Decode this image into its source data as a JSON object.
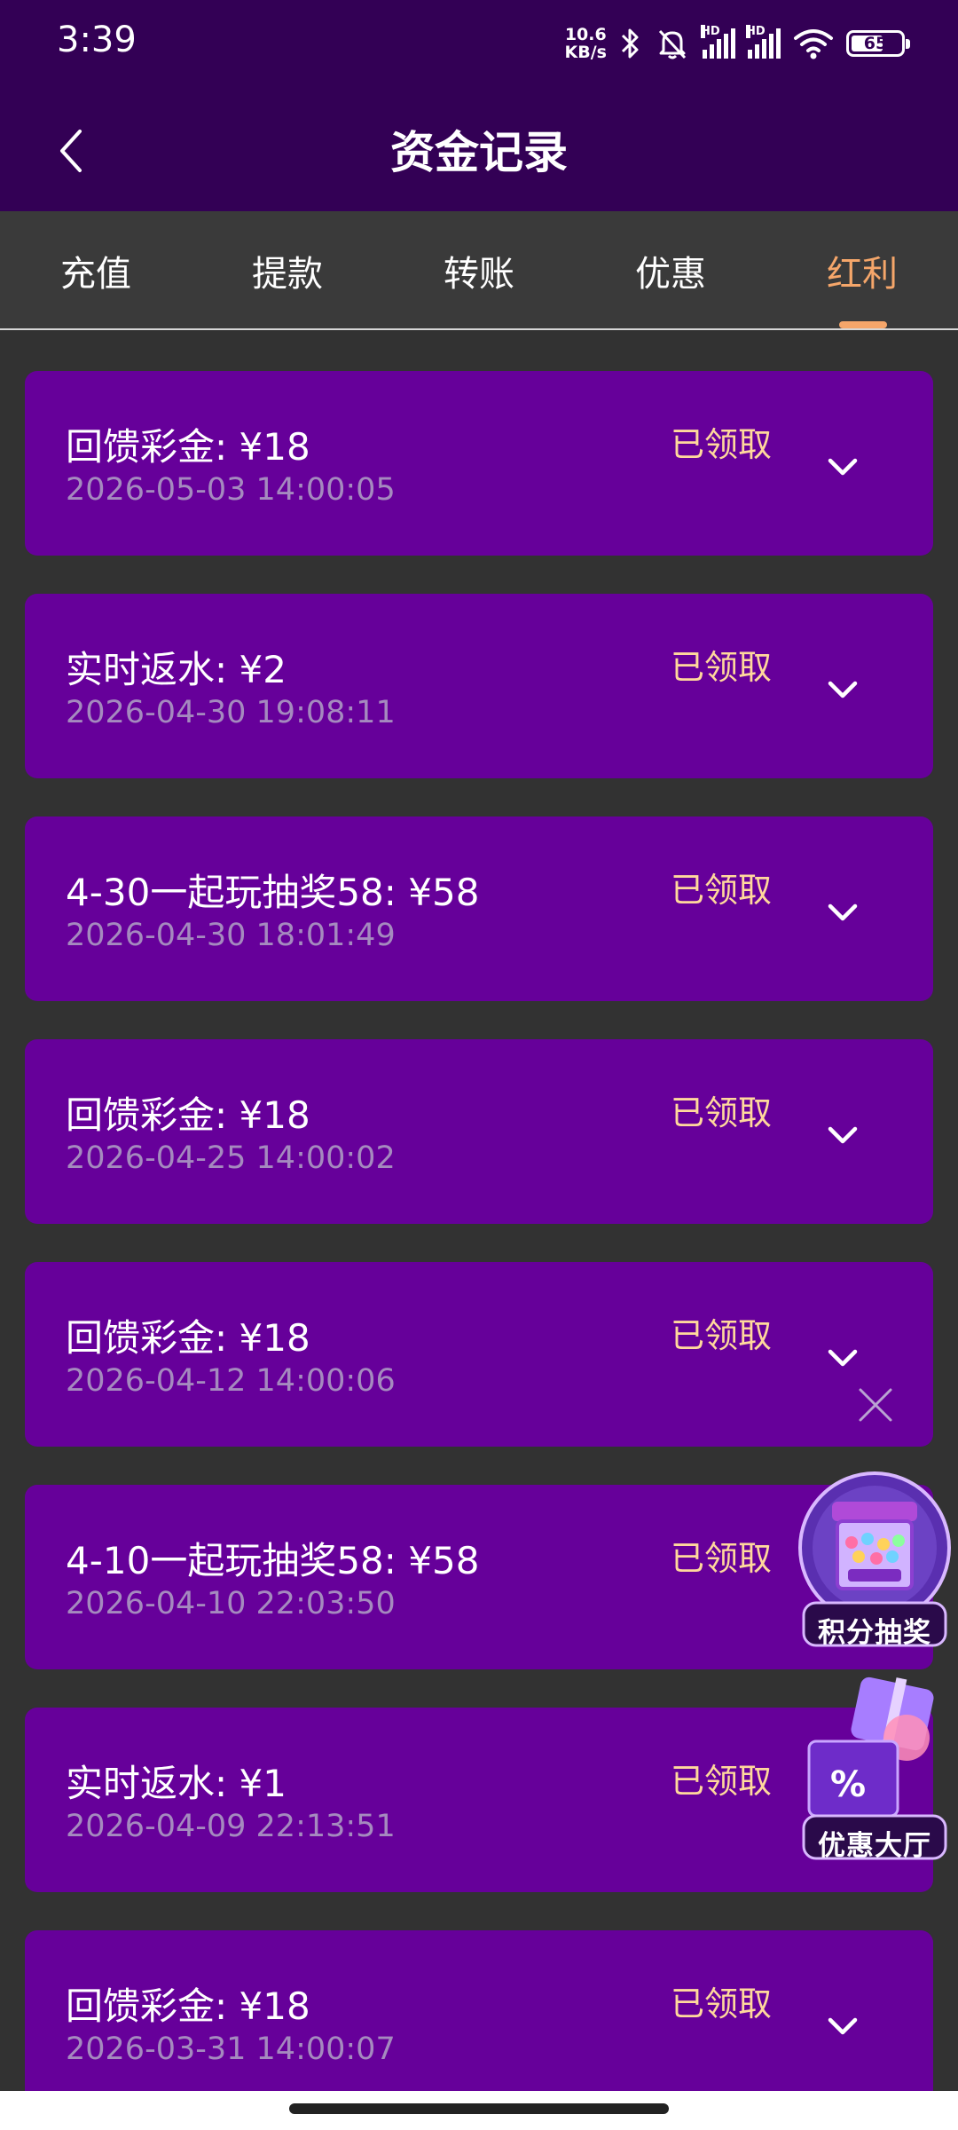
{
  "status_bar": {
    "time": "3:39",
    "net_speed_value": "10.6",
    "net_speed_unit": "KB/s",
    "signal_label": "HD",
    "battery_level": "65"
  },
  "header": {
    "title": "资金记录"
  },
  "tabs": {
    "items": [
      "充值",
      "提款",
      "转账",
      "优惠",
      "红利"
    ],
    "active_index": 4
  },
  "records": [
    {
      "title": "回馈彩金:  ¥18",
      "time": "2026-05-03 14:00:05",
      "status": "已领取"
    },
    {
      "title": "实时返水:  ¥2",
      "time": "2026-04-30 19:08:11",
      "status": "已领取"
    },
    {
      "title": "4-30一起玩抽奖58:  ¥58",
      "time": "2026-04-30 18:01:49",
      "status": "已领取"
    },
    {
      "title": "回馈彩金:  ¥18",
      "time": "2026-04-25 14:00:02",
      "status": "已领取"
    },
    {
      "title": "回馈彩金:  ¥18",
      "time": "2026-04-12 14:00:06",
      "status": "已领取"
    },
    {
      "title": "4-10一起玩抽奖58:  ¥58",
      "time": "2026-04-10 22:03:50",
      "status": "已领取"
    },
    {
      "title": "实时返水:  ¥1",
      "time": "2026-04-09 22:13:51",
      "status": "已领取"
    },
    {
      "title": "回馈彩金:  ¥18",
      "time": "2026-03-31 14:00:07",
      "status": "已领取"
    }
  ],
  "floating": {
    "lottery_label": "积分抽奖",
    "offers_label": "优惠大厅"
  },
  "colors": {
    "header_bg": "#330055",
    "card_bg": "#66009a",
    "accent": "#f5a66a",
    "status_text": "#ffd89c"
  }
}
